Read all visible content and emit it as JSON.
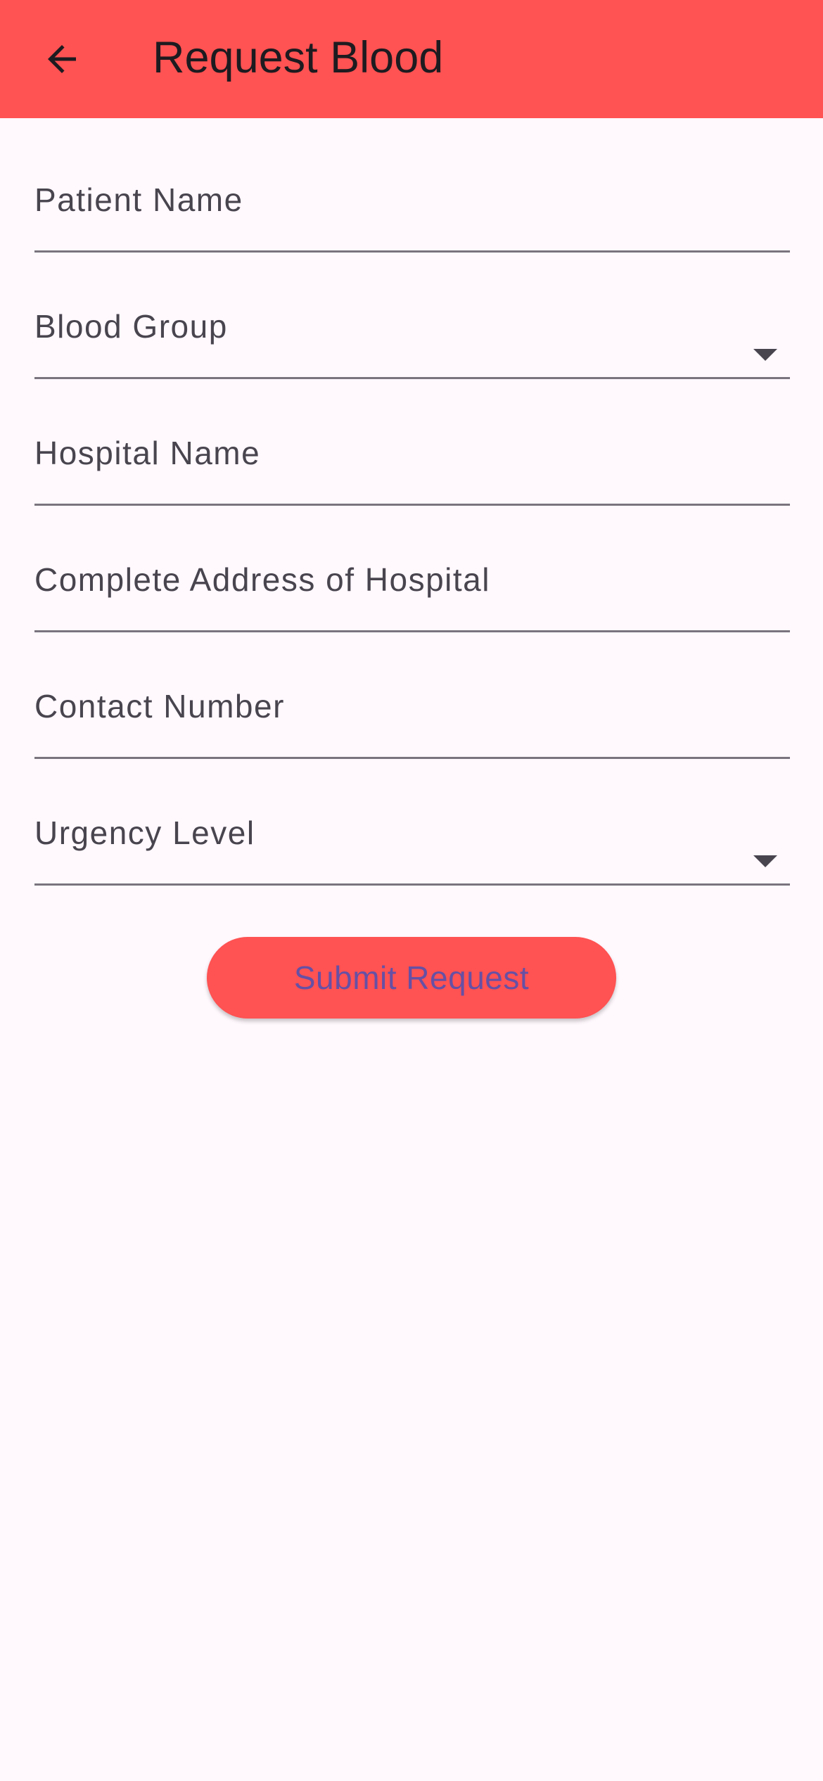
{
  "app_bar": {
    "title": "Request Blood",
    "back_icon": "arrow-left-icon",
    "background_color": "#ff5252"
  },
  "form": {
    "fields": [
      {
        "label": "Patient Name",
        "type": "text",
        "value": ""
      },
      {
        "label": "Blood Group",
        "type": "dropdown",
        "value": ""
      },
      {
        "label": "Hospital Name",
        "type": "text",
        "value": ""
      },
      {
        "label": "Complete Address of Hospital",
        "type": "text",
        "value": ""
      },
      {
        "label": "Contact Number",
        "type": "text",
        "value": ""
      },
      {
        "label": "Urgency Level",
        "type": "dropdown",
        "value": ""
      }
    ],
    "dropdown_icon": "caret-down-icon"
  },
  "submit": {
    "label": "Submit Request",
    "background_color": "#ff5252",
    "text_color": "#6750a4"
  }
}
